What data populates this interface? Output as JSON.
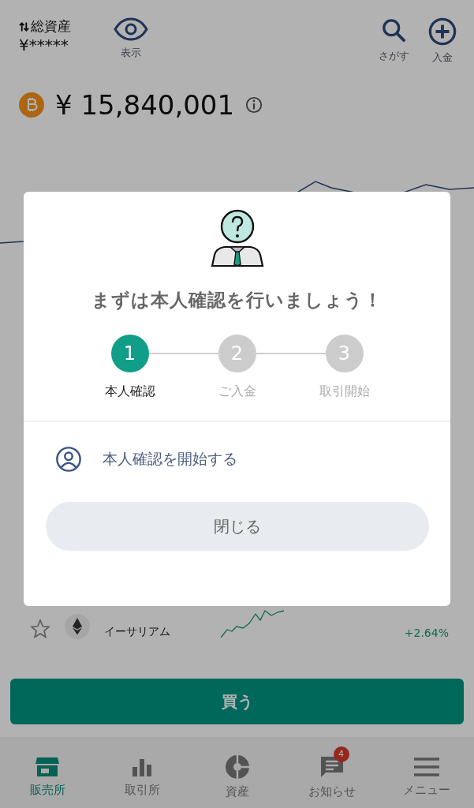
{
  "header": {
    "total_label": "総資産",
    "total_value": "¥*****",
    "show_label": "表示",
    "actions": [
      {
        "kind": "search",
        "label": "さがす"
      },
      {
        "kind": "deposit",
        "label": "入金"
      }
    ]
  },
  "price": {
    "value": "¥ 15,840,001"
  },
  "list": [
    {
      "name": "イーサリアム",
      "change": "+2.64%"
    }
  ],
  "modal": {
    "title": "まずは本人確認を行いましょう！",
    "steps": [
      {
        "number": "1",
        "label": "本人確認",
        "selected": true
      },
      {
        "number": "2",
        "label": "ご入金",
        "selected": false
      },
      {
        "number": "3",
        "label": "取引開始",
        "selected": false
      }
    ],
    "action": "本人確認を開始する",
    "close": "閉じる"
  },
  "buy_button": "買う",
  "nav": [
    {
      "kind": "shop",
      "label": "販売所",
      "selected": true
    },
    {
      "kind": "exchange",
      "label": "取引所",
      "selected": false
    },
    {
      "kind": "assets",
      "label": "資産",
      "selected": false
    },
    {
      "kind": "news",
      "label": "お知らせ",
      "selected": false,
      "badge": "4"
    },
    {
      "kind": "menu",
      "label": "メニュー",
      "selected": false
    }
  ]
}
